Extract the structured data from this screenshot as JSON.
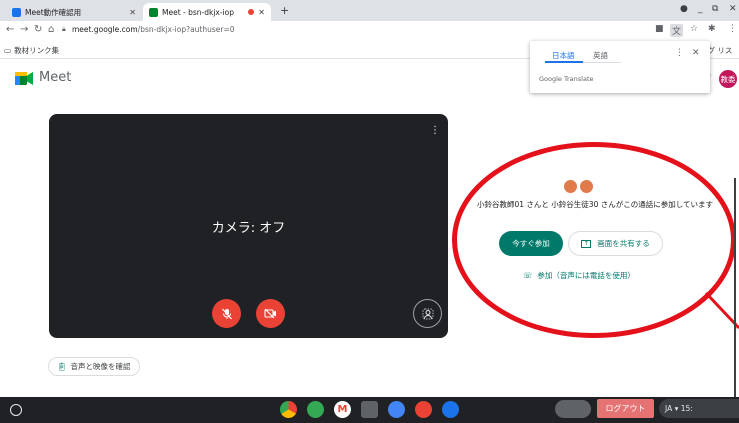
{
  "browser": {
    "tabs": [
      {
        "title": "Meet動作確認用",
        "active": false
      },
      {
        "title": "Meet - bsn-dkjx-iop",
        "active": true
      }
    ],
    "url_host": "meet.google.com",
    "url_path": "/bsn-dkjx-iop?authuser=0",
    "bookmark_folder": "教材リンク集",
    "bookmark_right": "ング リスト"
  },
  "translate": {
    "lang_selected": "日本語",
    "lang_other": "英語",
    "brand": "Google Translate"
  },
  "meet": {
    "title": "Meet",
    "account_text": "m\nる",
    "avatar_initial": "教委"
  },
  "preview": {
    "camera_status": "カメラ: オフ",
    "check_av_label": "音声と映像を確認"
  },
  "join": {
    "participants_text": "小鈴谷教師01 さんと 小鈴谷生徒30 さんがこの通話に参加しています",
    "join_now_label": "今すぐ参加",
    "present_label": "画面を共有する",
    "phone_label": "参加（音声には電話を使用）"
  },
  "shelf": {
    "logout_label": "ログアウト",
    "status_text": "JA ▾ 15:"
  },
  "colors": {
    "meet_green": "#00796b",
    "danger_red": "#ea4335",
    "annotation_red": "#e4101a"
  }
}
